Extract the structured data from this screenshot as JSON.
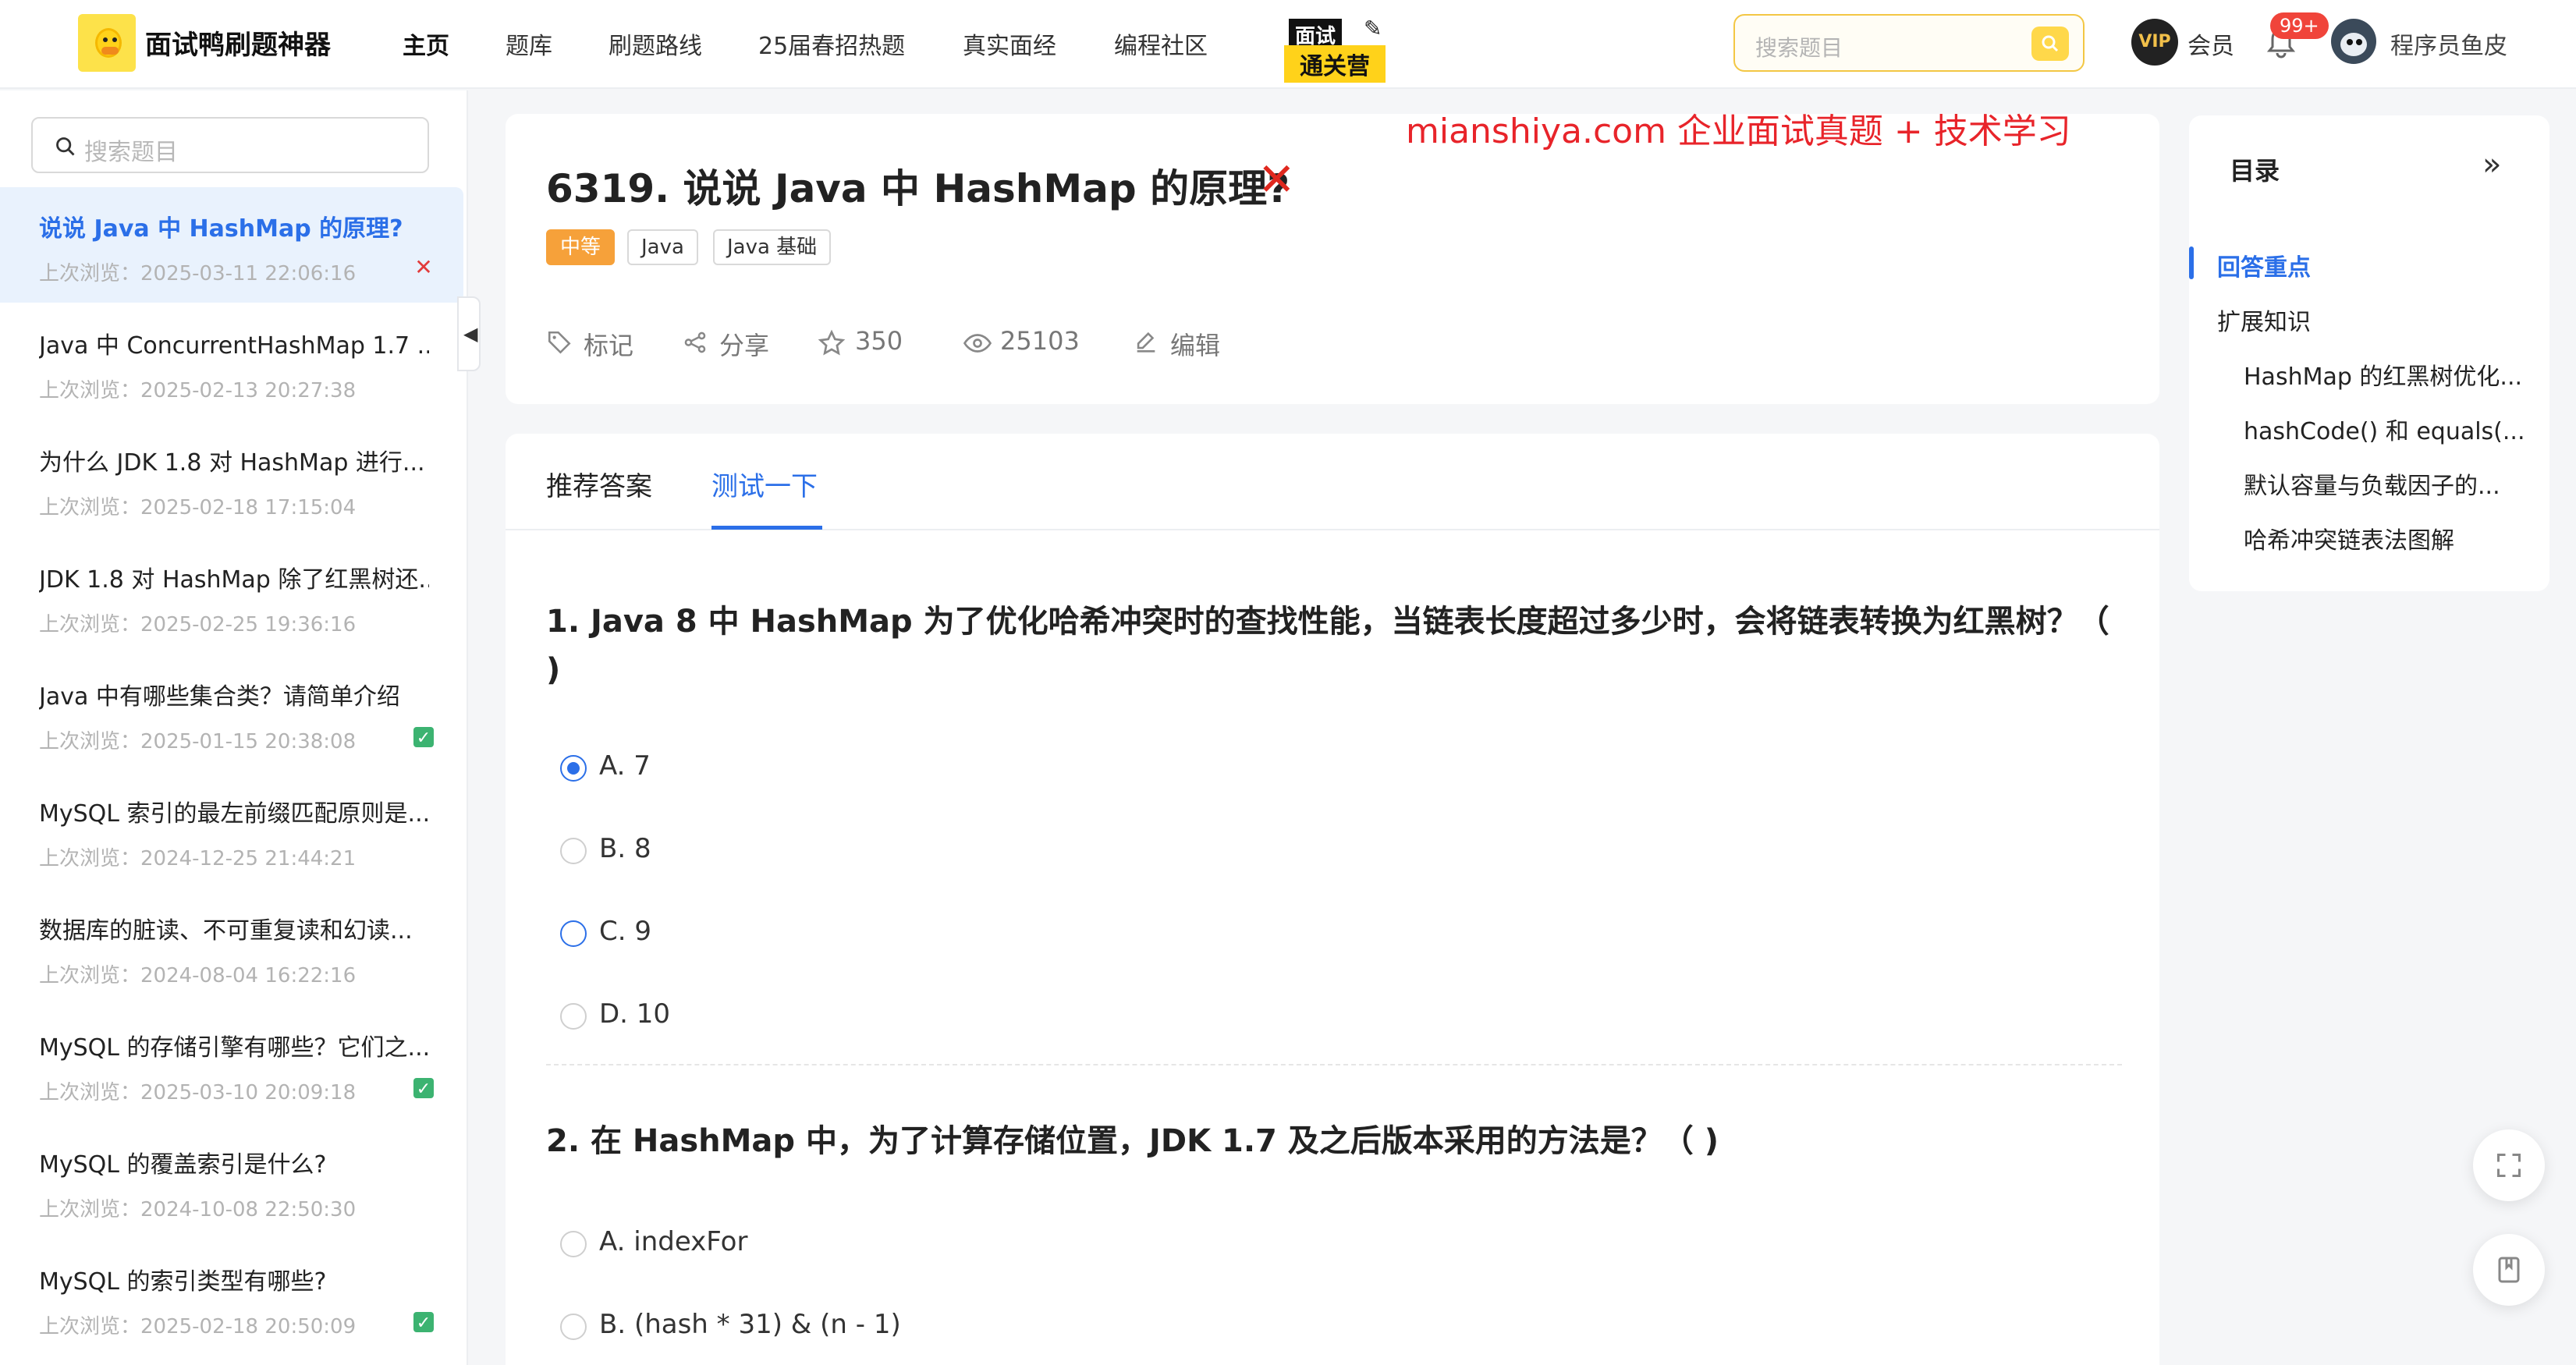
{
  "app": {
    "logo_text": "面试鸭刷题神器"
  },
  "nav": {
    "items": [
      "主页",
      "题库",
      "刷题路线",
      "25届春招热题",
      "真实面经",
      "编程社区"
    ],
    "camp_line1": "面试",
    "camp_line2": "通关营"
  },
  "top_search": {
    "placeholder": "搜索题目"
  },
  "user": {
    "vip_badge": "VIP",
    "vip_label": "会员",
    "notif_count": "99+",
    "name": "程序员鱼皮"
  },
  "sidebar": {
    "search_placeholder": "搜索题目",
    "items": [
      {
        "title": "说说 Java 中 HashMap 的原理?",
        "time": "上次浏览：2025-03-11 22:06:16",
        "mark": "✕"
      },
      {
        "title": "Java 中 ConcurrentHashMap 1.7 ...",
        "time": "上次浏览：2025-02-13 20:27:38",
        "mark": ""
      },
      {
        "title": "为什么 JDK 1.8 对 HashMap 进行...",
        "time": "上次浏览：2025-02-18 17:15:04",
        "mark": ""
      },
      {
        "title": "JDK 1.8 对 HashMap 除了红黑树还...",
        "time": "上次浏览：2025-02-25 19:36:16",
        "mark": ""
      },
      {
        "title": "Java 中有哪些集合类？请简单介绍",
        "time": "上次浏览：2025-01-15 20:38:08",
        "mark": "✓"
      },
      {
        "title": "MySQL 索引的最左前缀匹配原则是...",
        "time": "上次浏览：2024-12-25 21:44:21",
        "mark": ""
      },
      {
        "title": "数据库的脏读、不可重复读和幻读...",
        "time": "上次浏览：2024-08-04 16:22:16",
        "mark": ""
      },
      {
        "title": "MySQL 的存储引擎有哪些？它们之...",
        "time": "上次浏览：2025-03-10 20:09:18",
        "mark": "✓"
      },
      {
        "title": "MySQL 的覆盖索引是什么?",
        "time": "上次浏览：2024-10-08 22:50:30",
        "mark": ""
      },
      {
        "title": "MySQL 的索引类型有哪些?",
        "time": "上次浏览：2025-02-18 20:50:09",
        "mark": "✓"
      }
    ]
  },
  "watermark": "mianshiya.com 企业面试真题 + 技术学习",
  "question": {
    "title": "6319. 说说 Java 中 HashMap 的原理?",
    "status_mark": "✕",
    "tags": [
      "中等",
      "Java",
      "Java 基础"
    ],
    "actions": {
      "mark": "标记",
      "share": "分享",
      "stars": "350",
      "views": "25103",
      "edit": "编辑"
    }
  },
  "answer_tabs": [
    "推荐答案",
    "测试一下"
  ],
  "quiz": [
    {
      "question": "1. Java 8 中 HashMap 为了优化哈希冲突时的查找性能，当链表长度超过多少时，会将链表转换为红黑树？（ )",
      "options": [
        "A. 7",
        "B. 8",
        "C. 9",
        "D. 10"
      ],
      "selected": 0
    },
    {
      "question": "2. 在 HashMap 中，为了计算存储位置，JDK 1.7 及之后版本采用的方法是？（ )",
      "options": [
        "A. indexFor",
        "B. (hash * 31) & (n - 1)"
      ],
      "selected": -1
    }
  ],
  "toc": {
    "title": "目录",
    "items": [
      "回答重点",
      "扩展知识",
      "HashMap 的红黑树优化...",
      "hashCode() 和 equals(...",
      "默认容量与负载因子的...",
      "哈希冲突链表法图解"
    ]
  },
  "colors": {
    "accent": "#2b6fe8",
    "brand_yellow": "#ffd84a",
    "level_medium": "#f6a13a",
    "error": "#e0281e",
    "success": "#3cb371"
  }
}
